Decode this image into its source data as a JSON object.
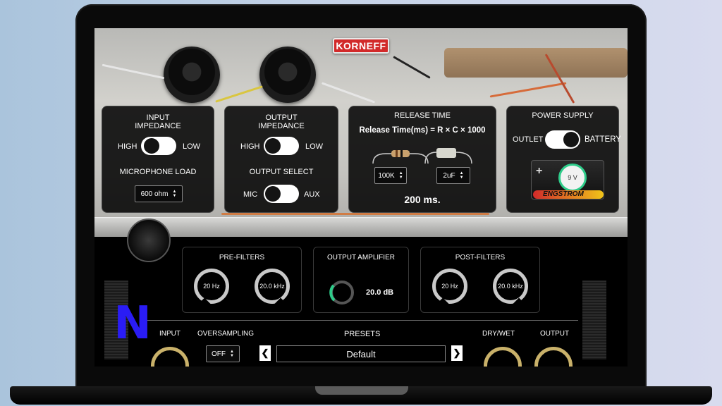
{
  "brand": {
    "logo": "KORNEFF",
    "monogram": "N"
  },
  "input_impedance": {
    "title": "INPUT\nIMPEDANCE",
    "high_label": "HIGH",
    "low_label": "LOW",
    "state": "HIGH",
    "load_title": "MICROPHONE LOAD",
    "load_value": "600 ohm"
  },
  "output_impedance": {
    "title": "OUTPUT\nIMPEDANCE",
    "high_label": "HIGH",
    "low_label": "LOW",
    "state": "HIGH",
    "select_title": "OUTPUT SELECT",
    "mic_label": "MIC",
    "aux_label": "AUX",
    "select_state": "MIC"
  },
  "release_time": {
    "title": "RELEASE TIME",
    "formula": "Release Time(ms) = R × C × 1000",
    "resistor_value": "100K",
    "capacitor_value": "2uF",
    "result": "200 ms."
  },
  "power_supply": {
    "title": "POWER SUPPLY",
    "outlet_label": "OUTLET",
    "battery_label": "BATTERY",
    "state": "OUTLET",
    "battery_voltage": "9 V",
    "battery_brand": "ENGSTROM",
    "battery_plus": "+"
  },
  "pre_filters": {
    "title": "PRE-FILTERS",
    "hp_value": "20 Hz",
    "lp_value": "20.0 kHz"
  },
  "output_amplifier": {
    "title": "OUTPUT AMPLIFIER",
    "gain": "20.0 dB"
  },
  "post_filters": {
    "title": "POST-FILTERS",
    "hp_value": "20 Hz",
    "lp_value": "20.0 kHz"
  },
  "bottom": {
    "input_label": "INPUT",
    "oversampling_label": "OVERSAMPLING",
    "oversampling_value": "OFF",
    "presets_label": "PRESETS",
    "preset_value": "Default",
    "prev_glyph": "❮",
    "next_glyph": "❯",
    "drywet_label": "DRY/WET",
    "output_label": "OUTPUT"
  },
  "colors": {
    "accent_green": "#2ecc8a",
    "logo_red": "#d22a2a",
    "monogram_blue": "#2a1cf5",
    "knob_gold": "#c9b16a"
  }
}
